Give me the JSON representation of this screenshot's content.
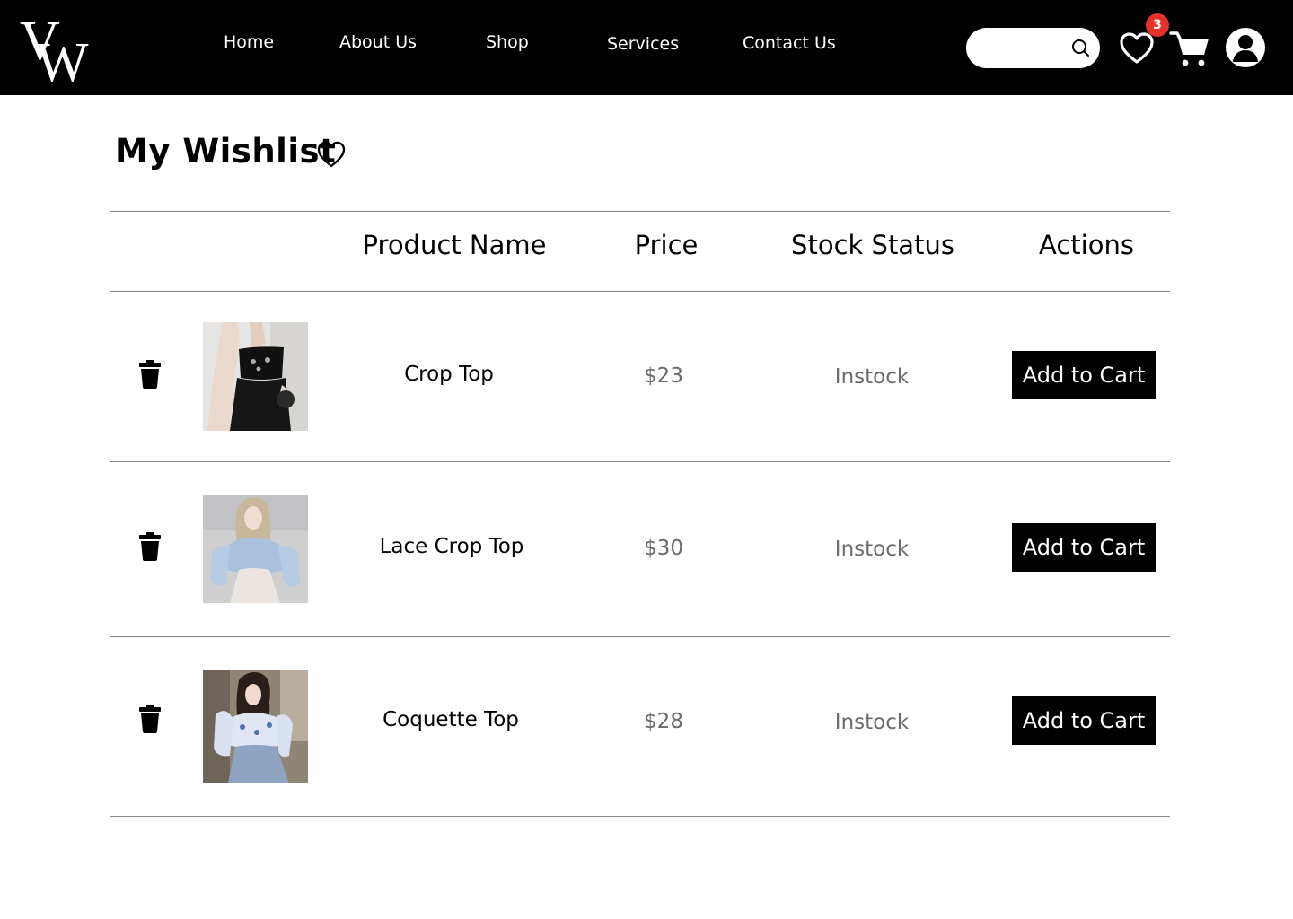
{
  "brand": {
    "logo_letters": "VW",
    "logo_icon": "vw-monogram-logo"
  },
  "nav": {
    "items": [
      {
        "label": "Home"
      },
      {
        "label": "About Us"
      },
      {
        "label": "Shop"
      },
      {
        "label": "Services"
      },
      {
        "label": "Contact Us"
      }
    ]
  },
  "header_actions": {
    "search_placeholder": "",
    "search_icon": "search-icon",
    "wishlist_icon": "heart-icon",
    "wishlist_count": "3",
    "cart_icon": "cart-icon",
    "profile_icon": "user-avatar-icon"
  },
  "page": {
    "title": "My Wishlist",
    "title_icon": "heart-outline-icon"
  },
  "table": {
    "headers": [
      "",
      "",
      "Product Name",
      "Price",
      "Stock Status",
      "Actions"
    ],
    "rows": [
      {
        "name": "Crop Top",
        "price": "$23",
        "stock": "Instock",
        "action": "Add to Cart",
        "image": "black embroidered cami crop top with black skirt"
      },
      {
        "name": "Lace Crop Top",
        "price": "$30",
        "stock": "Instock",
        "action": "Add to Cart",
        "image": "light blue lace puff-sleeve crop top"
      },
      {
        "name": "Coquette Top",
        "price": "$28",
        "stock": "Instock",
        "action": "Add to Cart",
        "image": "blue floral print long-sleeve crop top"
      }
    ]
  },
  "colors": {
    "header_bg": "#000000",
    "badge": "#e5322d",
    "button_bg": "#000000",
    "muted_text": "#6b6b6b",
    "divider": "#8a8a8a"
  }
}
